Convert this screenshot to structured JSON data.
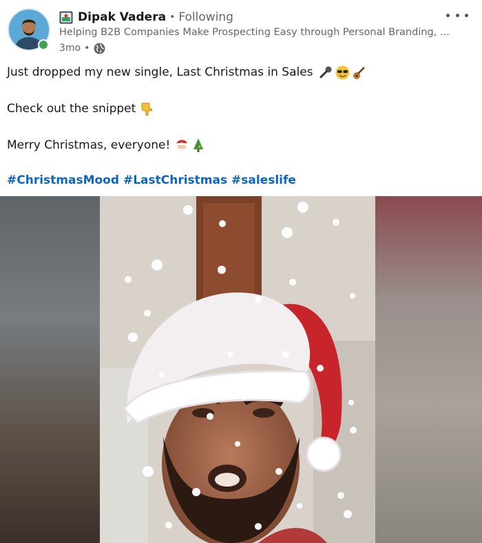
{
  "author": {
    "name": "Dipak Vadera",
    "connection_separator": "•",
    "following_label": "Following",
    "headline": "Helping B2B Companies Make Prospecting Easy through Personal Branding, ...",
    "age": "3mo",
    "meta_separator": "•",
    "visibility_icon": "globe-icon",
    "badge_icon": "linkedin-badge-icon"
  },
  "menu": {
    "icon": "more-options-icon"
  },
  "post": {
    "line1": "Just dropped my new single, Last Christmas in Sales",
    "line1_emojis": [
      "microphone-icon",
      "sunglasses-face-icon",
      "guitar-icon"
    ],
    "line2": "Check out the snippet",
    "line2_emojis": [
      "pointing-down-icon"
    ],
    "line3": "Merry Christmas, everyone!",
    "line3_emojis": [
      "santa-icon",
      "christmas-tree-icon"
    ],
    "hashtags": [
      "#ChristmasMood",
      "#LastChristmas",
      "#saleslife"
    ]
  },
  "media": {
    "type": "video",
    "description_icon": "video-frame"
  },
  "colors": {
    "link": "#0a66c2",
    "text": "#191919",
    "secondary": "#666666",
    "hat_red": "#c8242b"
  }
}
